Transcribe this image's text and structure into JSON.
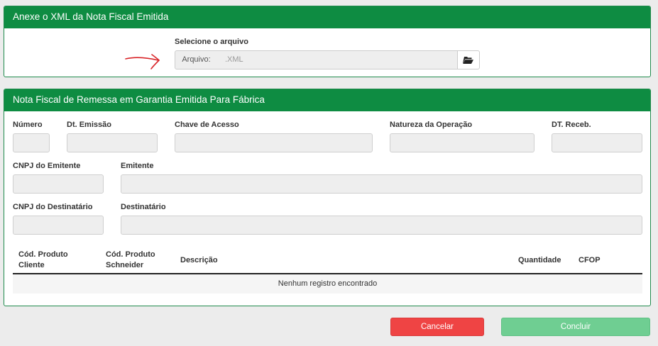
{
  "xml_panel": {
    "title": "Anexe o XML da Nota Fiscal Emitida",
    "select_label": "Selecione o arquivo",
    "addon_label": "Arquivo:",
    "file_placeholder": ".XML",
    "browse_icon": "folder-open-icon"
  },
  "nf_panel": {
    "title": "Nota Fiscal de Remessa em Garantia Emitida Para Fábrica",
    "fields": {
      "numero": {
        "label": "Número",
        "value": ""
      },
      "dt_emissao": {
        "label": "Dt. Emissão",
        "value": ""
      },
      "chave_acesso": {
        "label": "Chave de Acesso",
        "value": ""
      },
      "natureza_operacao": {
        "label": "Natureza da Operação",
        "value": ""
      },
      "dt_receb": {
        "label": "DT. Receb.",
        "value": ""
      },
      "cnpj_emitente": {
        "label": "CNPJ do Emitente",
        "value": ""
      },
      "emitente": {
        "label": "Emitente",
        "value": ""
      },
      "cnpj_destinatario": {
        "label": "CNPJ do Destinatário",
        "value": ""
      },
      "destinatario": {
        "label": "Destinatário",
        "value": ""
      }
    },
    "table": {
      "columns": {
        "cod_cliente_1": "Cód. Produto",
        "cod_cliente_2": "Cliente",
        "cod_schneider_1": "Cód. Produto",
        "cod_schneider_2": "Schneider",
        "descricao": "Descrição",
        "quantidade": "Quantidade",
        "cfop": "CFOP"
      },
      "empty_message": "Nenhum registro encontrado"
    }
  },
  "actions": {
    "cancel_label": "Cancelar",
    "confirm_label": "Concluir"
  },
  "colors": {
    "header_green": "#0e8c42",
    "cancel_red": "#ef4444",
    "confirm_green": "#6fce92",
    "annotation_arrow": "#d9262a"
  }
}
